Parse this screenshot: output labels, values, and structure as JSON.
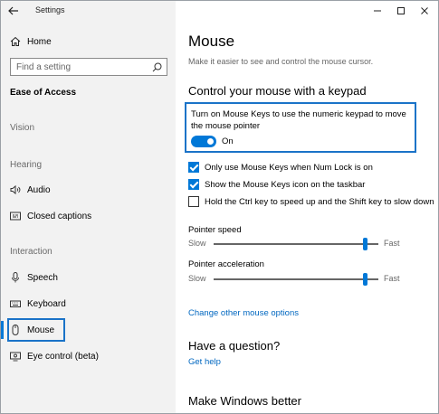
{
  "window": {
    "app_title": "Settings",
    "controls": [
      "minimize",
      "maximize",
      "close"
    ]
  },
  "sidebar": {
    "home_label": "Home",
    "search_placeholder": "Find a setting",
    "section_title": "Ease of Access",
    "groups": {
      "vision": "Vision",
      "hearing": "Hearing",
      "interaction": "Interaction"
    },
    "items": {
      "audio": "Audio",
      "closed_captions": "Closed captions",
      "speech": "Speech",
      "keyboard": "Keyboard",
      "mouse": "Mouse",
      "eye_control": "Eye control (beta)"
    },
    "selected": "Mouse"
  },
  "main": {
    "title": "Mouse",
    "subtitle": "Make it easier to see and control the mouse cursor.",
    "keypad_heading": "Control your mouse with a keypad",
    "mouse_keys_text": "Turn on Mouse Keys to use the numeric keypad to move the mouse pointer",
    "mouse_keys_toggle": {
      "state": "On",
      "on": true
    },
    "checkboxes": [
      {
        "label": "Only use Mouse Keys when Num Lock is on",
        "checked": true
      },
      {
        "label": "Show the Mouse Keys icon on the taskbar",
        "checked": true
      },
      {
        "label": "Hold the Ctrl key to speed up and the Shift key to slow down",
        "checked": false
      }
    ],
    "pointer_speed": {
      "label": "Pointer speed",
      "min_label": "Slow",
      "max_label": "Fast",
      "value_fraction": 0.92
    },
    "pointer_acceleration": {
      "label": "Pointer acceleration",
      "min_label": "Slow",
      "max_label": "Fast",
      "value_fraction": 0.92
    },
    "other_options_link": "Change other mouse options",
    "question_heading": "Have a question?",
    "get_help_link": "Get help",
    "make_better_heading": "Make Windows better"
  },
  "colors": {
    "accent": "#0078d7",
    "link": "#0067c0",
    "sidebar_bg": "#f2f2f2",
    "highlight_border": "#1a73c8"
  }
}
